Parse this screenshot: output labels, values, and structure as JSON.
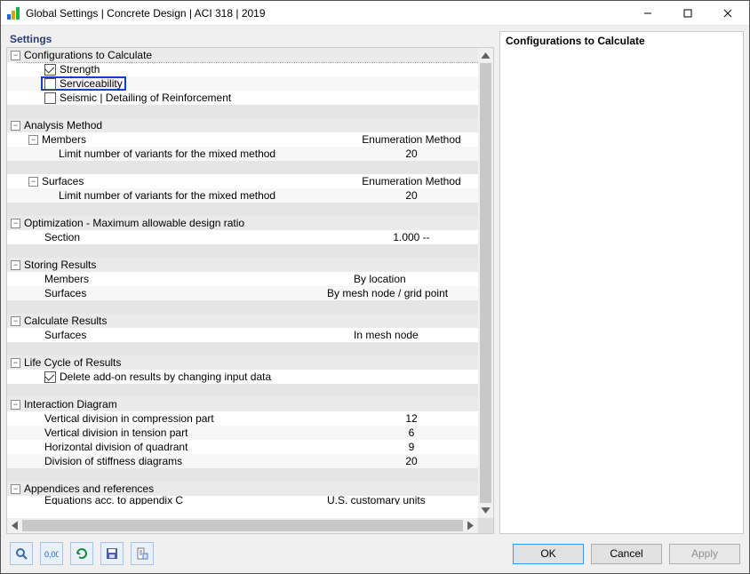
{
  "window": {
    "title": "Global Settings | Concrete Design | ACI 318 | 2019"
  },
  "left_panel": {
    "header": "Settings"
  },
  "right_panel": {
    "header": "Configurations to Calculate"
  },
  "tree": {
    "configs": {
      "header": "Configurations to Calculate",
      "strength": {
        "label": "Strength",
        "checked": true
      },
      "serviceability": {
        "label": "Serviceability",
        "checked": false,
        "highlighted": true
      },
      "seismic": {
        "label": "Seismic | Detailing of Reinforcement",
        "checked": false
      }
    },
    "analysis": {
      "header": "Analysis Method",
      "members": {
        "label": "Members",
        "value": "Enumeration Method"
      },
      "members_limit": {
        "label": "Limit number of variants for the mixed method",
        "value": "20"
      },
      "surfaces": {
        "label": "Surfaces",
        "value": "Enumeration Method"
      },
      "surfaces_limit": {
        "label": "Limit number of variants for the mixed method",
        "value": "20"
      }
    },
    "optimization": {
      "header": "Optimization - Maximum allowable design ratio",
      "section": {
        "label": "Section",
        "value": "1.000 --"
      }
    },
    "storing": {
      "header": "Storing Results",
      "members": {
        "label": "Members",
        "value": "By location"
      },
      "surfaces": {
        "label": "Surfaces",
        "value": "By mesh node / grid point"
      }
    },
    "calculate": {
      "header": "Calculate Results",
      "surfaces": {
        "label": "Surfaces",
        "value": "In mesh node"
      }
    },
    "lifecycle": {
      "header": "Life Cycle of Results",
      "delete": {
        "label": "Delete add-on results by changing input data",
        "checked": true
      }
    },
    "interaction": {
      "header": "Interaction Diagram",
      "v_comp": {
        "label": "Vertical division in compression part",
        "value": "12"
      },
      "v_tens": {
        "label": "Vertical division in tension part",
        "value": "6"
      },
      "h_quad": {
        "label": "Horizontal division of quadrant",
        "value": "9"
      },
      "stiff": {
        "label": "Division of stiffness diagrams",
        "value": "20"
      }
    },
    "appendices": {
      "header": "Appendices and references",
      "eq_c": {
        "label": "Equations acc. to appendix C",
        "value": "U.S. customary units"
      }
    }
  },
  "buttons": {
    "ok": "OK",
    "cancel": "Cancel",
    "apply": "Apply"
  }
}
